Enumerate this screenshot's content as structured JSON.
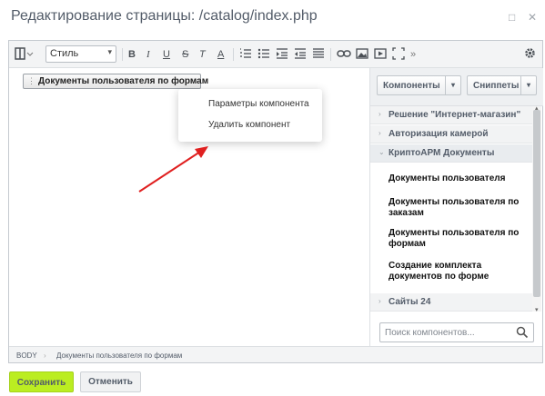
{
  "window": {
    "title": "Редактирование страницы: /catalog/index.php",
    "minimize_glyph": "□",
    "close_glyph": "✕"
  },
  "toolbar": {
    "style_select_value": "Стиль",
    "bold": "B",
    "italic": "I",
    "underline": "U",
    "strike": "S",
    "clear_format": "T",
    "font_color": "A",
    "more": "»",
    "icons": [
      "view-mode-icon",
      "bold-icon",
      "italic-icon",
      "underline-icon",
      "strikethrough-icon",
      "clear-format-icon",
      "font-color-icon",
      "ordered-list-icon",
      "unordered-list-icon",
      "indent-icon",
      "outdent-icon",
      "align-icon",
      "link-icon",
      "image-icon",
      "video-icon",
      "fullscreen-icon",
      "more-icon",
      "settings-icon"
    ]
  },
  "content": {
    "component_chip": "Документы пользователя по формам"
  },
  "context_menu": {
    "items": [
      "Параметры компонента",
      "Удалить компонент"
    ]
  },
  "sidebar": {
    "components_button": "Компоненты",
    "snippets_button": "Сниппеты",
    "categories": [
      {
        "label": "Решение \"Интернет-магазин\"",
        "open": false
      },
      {
        "label": "Авторизация камерой",
        "open": false
      },
      {
        "label": "КриптоАРМ Документы",
        "open": true
      },
      {
        "label": "Сайты 24",
        "open": false
      }
    ],
    "items": [
      "Документы пользователя",
      "Документы пользователя по заказам",
      "Документы пользователя по формам",
      "Создание комплекта документов по форме"
    ],
    "search_placeholder": "Поиск компонентов..."
  },
  "statusbar": {
    "path": [
      "BODY",
      "Документы пользователя по формам"
    ]
  },
  "footer": {
    "save_label": "Сохранить",
    "cancel_label": "Отменить"
  },
  "colors": {
    "save_accent": "#bbed21",
    "arrow": "#e02020"
  }
}
